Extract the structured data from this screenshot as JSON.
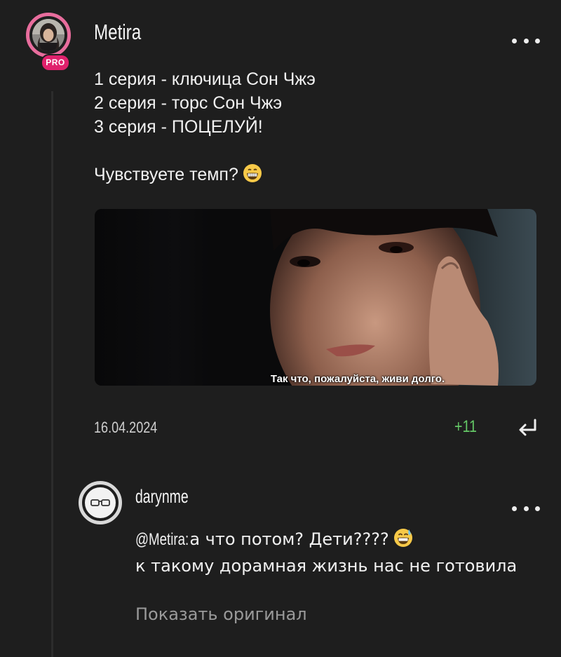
{
  "comment": {
    "username": "Metira",
    "badge": "PRO",
    "lines": [
      "1 серия - ключица Сон Чжэ",
      "2 серия - торс Сон Чжэ",
      "3 серия - ПОЦЕЛУЙ!"
    ],
    "question": "Чувствуете темп?",
    "question_emoji": "grinning-face-icon",
    "media_subtitle": "Так что, пожалуйста, живи долго.",
    "date": "16.04.2024",
    "score": "+11",
    "reply_icon": "reply-arrow-icon",
    "more_icon": "more-dots-icon"
  },
  "reply": {
    "username": "darynme",
    "mention": "@Metira:",
    "text_line1": " а что потом? Дети????",
    "text_rest": "к такому дорамная жизнь нас не готовила",
    "emoji": "sweat-smile-icon",
    "show_original": "Показать оригинал",
    "more_icon": "more-dots-icon"
  },
  "colors": {
    "background": "#1e1e1e",
    "pro_badge": "#e0216c",
    "avatar_ring": "#e86d9d",
    "score": "#64c866",
    "muted_text": "#9a9a9a"
  }
}
